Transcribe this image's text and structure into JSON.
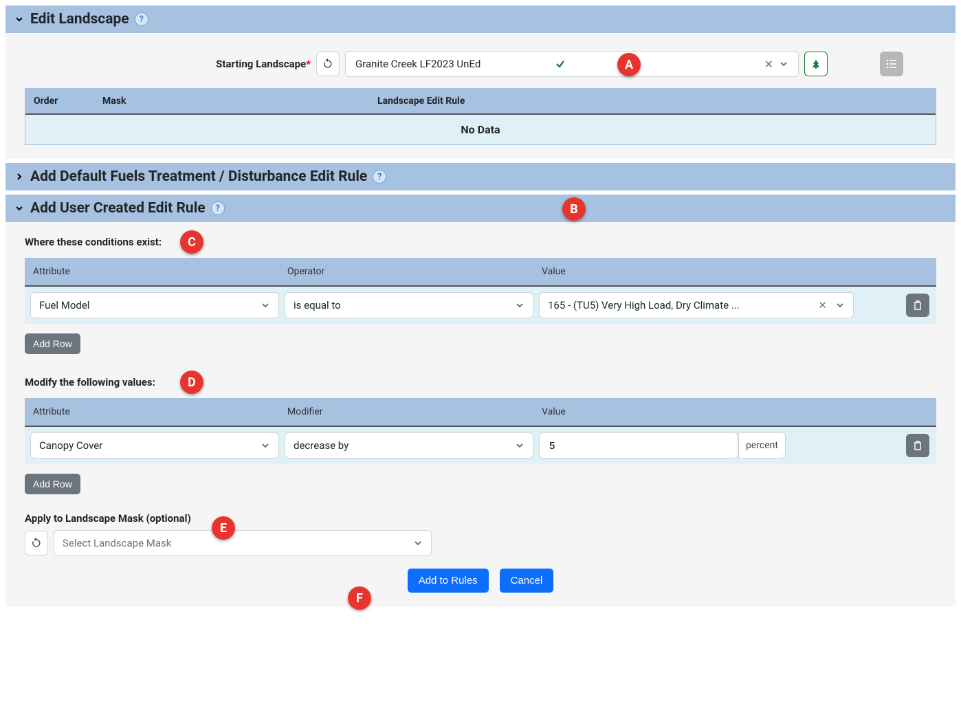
{
  "panels": {
    "edit_landscape": {
      "title": "Edit Landscape",
      "expanded": true
    },
    "default_rule": {
      "title": "Add Default Fuels Treatment / Disturbance Edit Rule",
      "expanded": false
    },
    "user_rule": {
      "title": "Add User Created Edit Rule",
      "expanded": true
    }
  },
  "starting_landscape": {
    "label": "Starting Landscape",
    "value": "Granite Creek LF2023 UnEd"
  },
  "rules_table": {
    "headers": {
      "order": "Order",
      "mask": "Mask",
      "rule": "Landscape Edit Rule"
    },
    "empty": "No Data"
  },
  "conditions": {
    "label": "Where these conditions exist:",
    "headers": {
      "attr": "Attribute",
      "op": "Operator",
      "val": "Value"
    },
    "rows": [
      {
        "attr": "Fuel Model",
        "op": "is equal to",
        "val": "165 - (TU5) Very High Load, Dry Climate ..."
      }
    ],
    "add_row": "Add Row"
  },
  "modifications": {
    "label": "Modify the following values:",
    "headers": {
      "attr": "Attribute",
      "mod": "Modifier",
      "val": "Value"
    },
    "rows": [
      {
        "attr": "Canopy Cover",
        "mod": "decrease by",
        "val": "5",
        "unit": "percent"
      }
    ],
    "add_row": "Add Row"
  },
  "mask": {
    "label": "Apply to Landscape Mask (optional)",
    "placeholder": "Select Landscape Mask"
  },
  "buttons": {
    "add_rules": "Add to Rules",
    "cancel": "Cancel"
  },
  "callouts": {
    "a": "A",
    "b": "B",
    "c": "C",
    "d": "D",
    "e": "E",
    "f": "F"
  }
}
